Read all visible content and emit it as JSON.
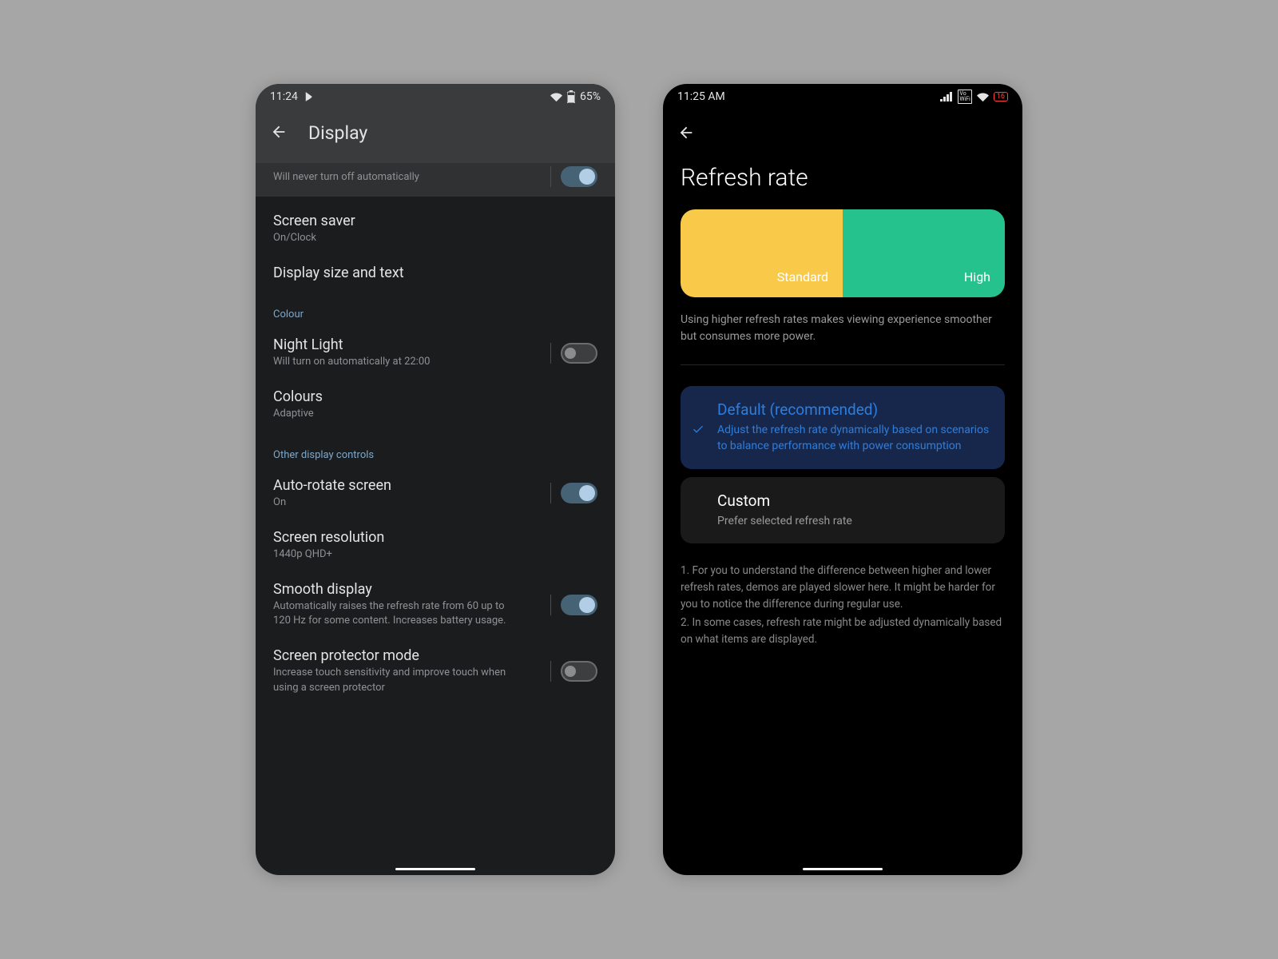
{
  "phone1": {
    "status": {
      "time": "11:24",
      "battery_text": "65%"
    },
    "header": {
      "title": "Display"
    },
    "clipped_row": {
      "sub": "Will never turn off automatically",
      "toggle": true
    },
    "sections": {
      "top_items": [
        {
          "title": "Screen saver",
          "sub": "On/Clock"
        },
        {
          "title": "Display size and text",
          "sub": ""
        }
      ],
      "colour_label": "Colour",
      "colour_items": [
        {
          "title": "Night Light",
          "sub": "Will turn on automatically at 22:00",
          "toggle": false
        },
        {
          "title": "Colours",
          "sub": "Adaptive"
        }
      ],
      "other_label": "Other display controls",
      "other_items": [
        {
          "title": "Auto-rotate screen",
          "sub": "On",
          "toggle": true
        },
        {
          "title": "Screen resolution",
          "sub": "1440p QHD+"
        },
        {
          "title": "Smooth display",
          "sub": "Automatically raises the refresh rate from 60 up to 120 Hz for some content. Increases battery usage.",
          "toggle": true
        },
        {
          "title": "Screen protector mode",
          "sub": "Increase touch sensitivity and improve touch when using a screen protector",
          "toggle": false
        }
      ]
    }
  },
  "phone2": {
    "status": {
      "time": "11:25 AM",
      "battery_text": "16"
    },
    "title": "Refresh rate",
    "seg": {
      "standard": "Standard",
      "high": "High"
    },
    "note": "Using higher refresh rates makes viewing experience smoother but consumes more power.",
    "options": {
      "default_title": "Default (recommended)",
      "default_sub": "Adjust the refresh rate dynamically based on scenarios to balance performance with power consumption",
      "custom_title": "Custom",
      "custom_sub": "Prefer selected refresh rate"
    },
    "footnotes": {
      "n1": "1. For you to understand the difference between higher and lower refresh rates, demos are played slower here. It might be harder for you to notice the difference during regular use.",
      "n2": "2. In some cases, refresh rate might be adjusted dynamically based on what items are displayed."
    }
  }
}
